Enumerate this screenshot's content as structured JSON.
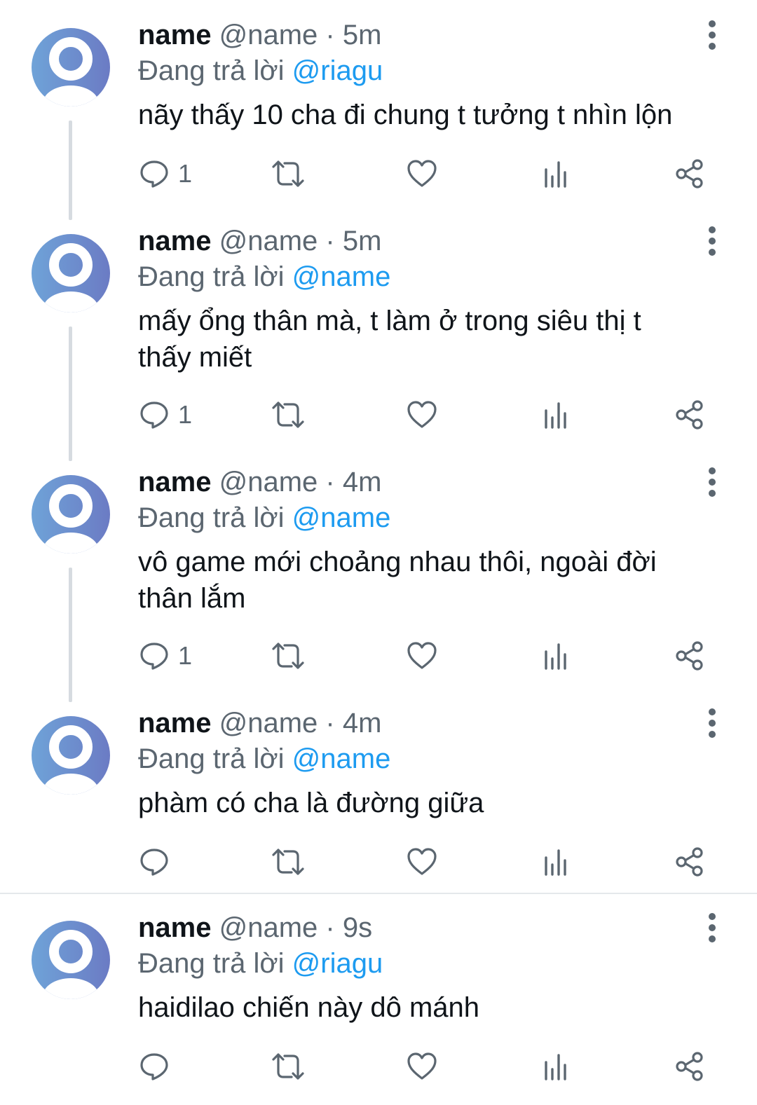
{
  "tweets": [
    {
      "display_name": "name",
      "handle": "@name",
      "separator": "·",
      "time": "5m",
      "reply_prefix": "Đang trả lời",
      "reply_target": "@riagu",
      "text": "nãy thấy 10 cha đi chung t tưởng t nhìn lộn",
      "reply_count": "1"
    },
    {
      "display_name": "name",
      "handle": "@name",
      "separator": "·",
      "time": "5m",
      "reply_prefix": "Đang trả lời",
      "reply_target": "@name",
      "text": "mấy ổng thân mà, t làm ở trong siêu thị t thấy miết",
      "reply_count": "1"
    },
    {
      "display_name": "name",
      "handle": "@name",
      "separator": "·",
      "time": "4m",
      "reply_prefix": "Đang trả lời",
      "reply_target": "@name",
      "text": "vô game mới choảng nhau thôi, ngoài đời thân lắm",
      "reply_count": "1"
    },
    {
      "display_name": "name",
      "handle": "@name",
      "separator": "·",
      "time": "4m",
      "reply_prefix": "Đang trả lời",
      "reply_target": "@name",
      "text": "phàm có cha là đường giữa",
      "reply_count": ""
    },
    {
      "display_name": "name",
      "handle": "@name",
      "separator": "·",
      "time": "9s",
      "reply_prefix": "Đang trả lời",
      "reply_target": "@riagu",
      "text": "haidilao chiến này dô mánh",
      "reply_count": ""
    }
  ],
  "icons": {
    "reply": "reply-icon",
    "retweet": "retweet-icon",
    "like": "heart-icon",
    "views": "analytics-icon",
    "share": "share-icon",
    "more": "more-vertical-icon",
    "avatar": "default-avatar-icon"
  },
  "colors": {
    "accent": "#1d9bf0",
    "secondary_text": "#5b6670",
    "primary_text": "#0f1419",
    "icon": "#5b6670",
    "thread_line": "#d6dbe0",
    "avatar_gradient_start": "#6fa3d8",
    "avatar_gradient_end": "#6b7bc4"
  }
}
